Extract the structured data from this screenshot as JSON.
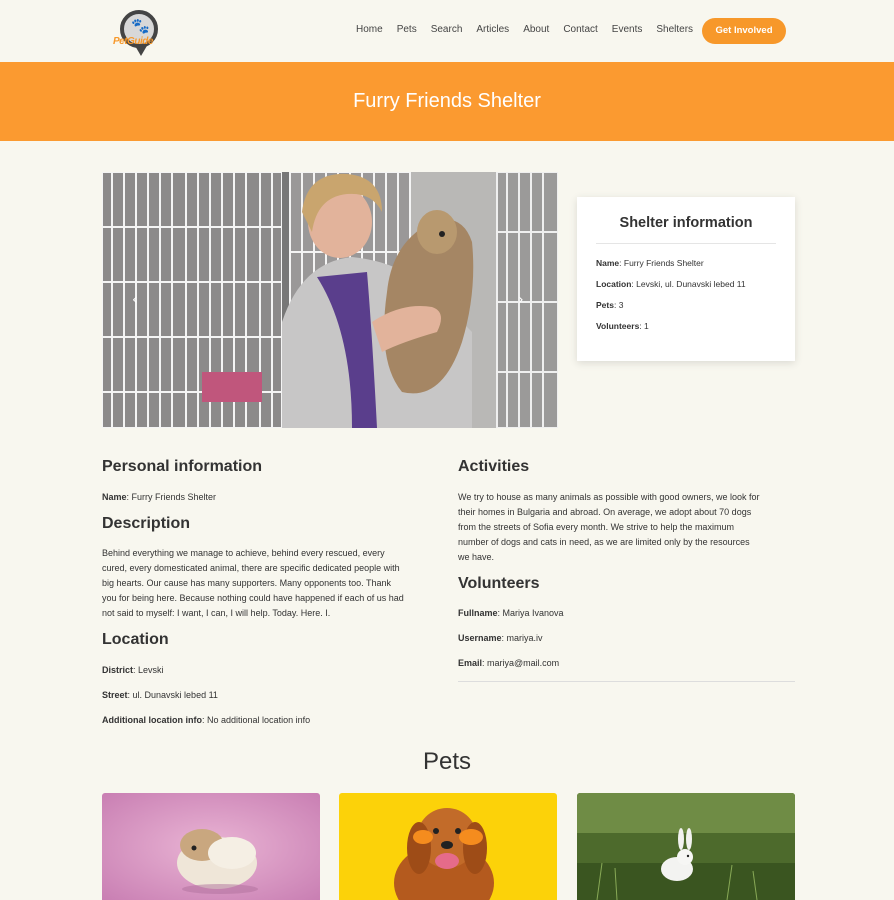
{
  "header": {
    "logo_text": "PetGuide",
    "nav": [
      "Home",
      "Pets",
      "Search",
      "Articles",
      "About",
      "Contact",
      "Events",
      "Shelters"
    ],
    "cta_label": "Get Involved"
  },
  "banner": {
    "title": "Furry Friends Shelter"
  },
  "info_card": {
    "title": "Shelter information",
    "rows": [
      {
        "label": "Name",
        "value": "Furry Friends Shelter"
      },
      {
        "label": "Location",
        "value": "Levski, ul. Dunavski lebed 11"
      },
      {
        "label": "Pets",
        "value": "3"
      },
      {
        "label": "Volunteers",
        "value": "1"
      }
    ]
  },
  "personal": {
    "title": "Personal information",
    "name_label": "Name",
    "name_value": "Furry Friends Shelter"
  },
  "description": {
    "title": "Description",
    "lines": [
      "Behind everything we manage to achieve, behind every rescued, every",
      "cured, every domesticated animal, there are specific dedicated people with",
      "big hearts. Our cause has many supporters. Many opponents too. Thank",
      "you for being here. Because nothing could have happened if each of us had",
      "not said to myself: I want, I can, I will help. Today. Here. I."
    ]
  },
  "location": {
    "title": "Location",
    "rows": [
      {
        "label": "District",
        "value": "Levski"
      },
      {
        "label": "Street",
        "value": "ul. Dunavski lebed 11"
      },
      {
        "label": "Additional location info",
        "value": "No additional location info"
      }
    ]
  },
  "activities": {
    "title": "Activities",
    "lines": [
      "We try to house as many animals as possible with good owners, we look for",
      "their homes in Bulgaria and abroad. On average, we adopt about 70 dogs",
      "from the streets of Sofia every month. We strive to help the maximum",
      "number of dogs and cats in need, as we are limited only by the resources",
      "we have."
    ]
  },
  "volunteers": {
    "title": "Volunteers",
    "rows": [
      {
        "label": "Fullname",
        "value": "Mariya Ivanova"
      },
      {
        "label": "Username",
        "value": "mariya.iv"
      },
      {
        "label": "Email",
        "value": "mariya@mail.com"
      }
    ]
  },
  "pets": {
    "title": "Pets"
  },
  "colors": {
    "accent": "#fb9a30",
    "background": "#f8f7ef"
  }
}
